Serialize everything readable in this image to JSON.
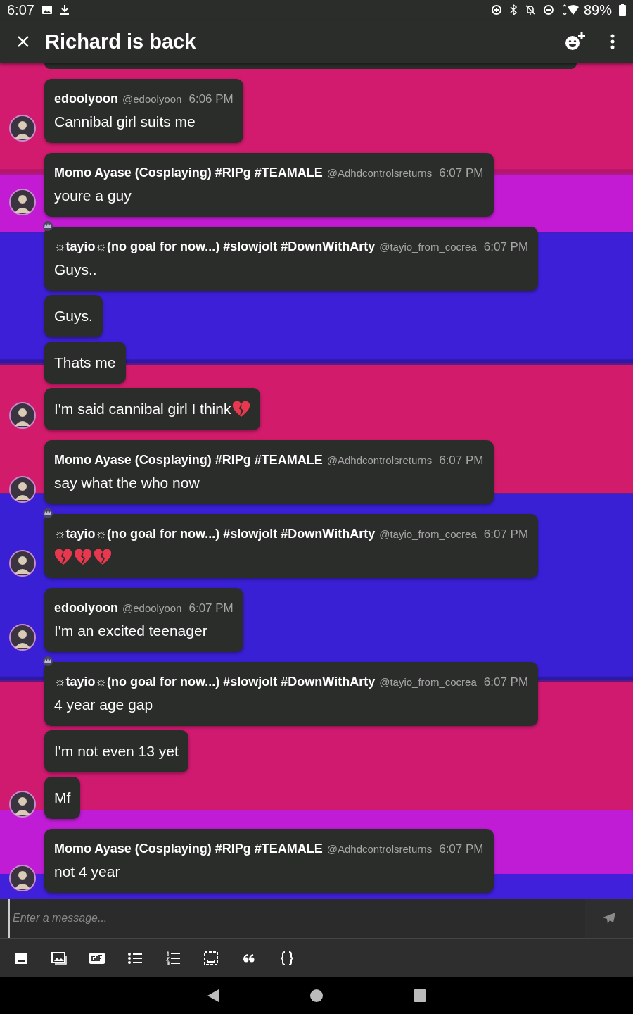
{
  "status_bar": {
    "time": "6:07",
    "battery": "89%"
  },
  "header": {
    "title": "Richard is back"
  },
  "groups": [
    {
      "crown": false,
      "author": "edoolyoon",
      "handle": "@edoolyoon",
      "time": "6:06 PM",
      "messages": [
        {
          "text": "Cannibal girl suits me"
        }
      ]
    },
    {
      "crown": false,
      "author": "Momo Ayase (Cosplaying) #RIPg #TEAMALE",
      "handle": "@Adhdcontrolsreturns",
      "time": "6:07 PM",
      "messages": [
        {
          "text": "youre a guy"
        }
      ]
    },
    {
      "crown": true,
      "author": "☼tayio☼(no goal for now...) #slowjolt #DownWithArty",
      "handle": "@tayio_from_cocrea",
      "time": "6:07 PM",
      "messages": [
        {
          "text": "Guys.."
        },
        {
          "text": "Guys."
        },
        {
          "text": "Thats me"
        },
        {
          "text": "I'm said cannibal girl I think",
          "emojis": [
            {
              "kind": "broken_heart"
            }
          ]
        }
      ]
    },
    {
      "crown": false,
      "author": "Momo Ayase (Cosplaying) #RIPg #TEAMALE",
      "handle": "@Adhdcontrolsreturns",
      "time": "6:07 PM",
      "messages": [
        {
          "text": "say what the who now"
        }
      ]
    },
    {
      "crown": true,
      "author": "☼tayio☼(no goal for now...) #slowjolt #DownWithArty",
      "handle": "@tayio_from_cocrea",
      "time": "6:07 PM",
      "messages": [
        {
          "emojis": [
            {
              "kind": "broken_heart"
            },
            {
              "kind": "broken_heart"
            },
            {
              "kind": "broken_heart"
            }
          ]
        }
      ]
    },
    {
      "crown": false,
      "author": "edoolyoon",
      "handle": "@edoolyoon",
      "time": "6:07 PM",
      "messages": [
        {
          "text": "I'm an excited teenager"
        }
      ]
    },
    {
      "crown": true,
      "author": "☼tayio☼(no goal for now...) #slowjolt #DownWithArty",
      "handle": "@tayio_from_cocrea",
      "time": "6:07 PM",
      "messages": [
        {
          "text": "4 year age gap"
        },
        {
          "text": "I'm not even 13 yet"
        },
        {
          "text": "Mf"
        }
      ]
    },
    {
      "crown": false,
      "author": "Momo Ayase (Cosplaying) #RIPg #TEAMALE",
      "handle": "@Adhdcontrolsreturns",
      "time": "6:07 PM",
      "messages": [
        {
          "text": "not 4 year"
        }
      ]
    }
  ],
  "composer": {
    "placeholder": "Enter a message..."
  }
}
